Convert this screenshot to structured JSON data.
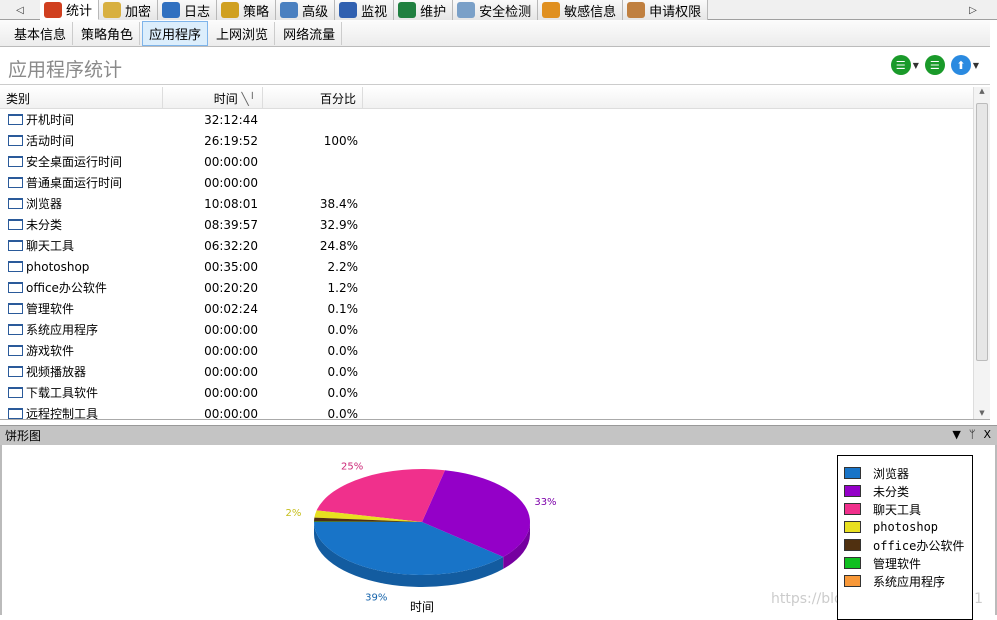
{
  "tabs": [
    {
      "label": "统计",
      "icon": "bar-chart-icon",
      "color": "#d04020",
      "active": true
    },
    {
      "label": "加密",
      "icon": "lock-icon",
      "color": "#d8b040"
    },
    {
      "label": "日志",
      "icon": "log-stack-icon",
      "color": "#3070c0"
    },
    {
      "label": "策略",
      "icon": "policy-gear-icon",
      "color": "#d0a020"
    },
    {
      "label": "高级",
      "icon": "advanced-user-icon",
      "color": "#4a80c0"
    },
    {
      "label": "监视",
      "icon": "camera-icon",
      "color": "#3060b0"
    },
    {
      "label": "维护",
      "icon": "monitor-icon",
      "color": "#208040"
    },
    {
      "label": "安全检测",
      "icon": "security-scan-icon",
      "color": "#7aa0c8"
    },
    {
      "label": "敏感信息",
      "icon": "warning-icon",
      "color": "#e09020"
    },
    {
      "label": "申请权限",
      "icon": "pencil-icon",
      "color": "#c08040"
    }
  ],
  "subtabs": [
    {
      "label": "基本信息"
    },
    {
      "label": "策略角色"
    },
    {
      "label": "应用程序",
      "selected": true
    },
    {
      "label": "上网浏览"
    },
    {
      "label": "网络流量"
    }
  ],
  "page_title": "应用程序统计",
  "table": {
    "headers": [
      "类别",
      "时间",
      "百分比"
    ],
    "sort_indicator": "╲╵",
    "rows": [
      [
        "开机时间",
        "32:12:44",
        ""
      ],
      [
        "活动时间",
        "26:19:52",
        "100%"
      ],
      [
        "安全桌面运行时间",
        "00:00:00",
        ""
      ],
      [
        "普通桌面运行时间",
        "00:00:00",
        ""
      ],
      [
        "浏览器",
        "10:08:01",
        "38.4%"
      ],
      [
        "未分类",
        "08:39:57",
        "32.9%"
      ],
      [
        "聊天工具",
        "06:32:20",
        "24.8%"
      ],
      [
        "photoshop",
        "00:35:00",
        "2.2%"
      ],
      [
        "office办公软件",
        "00:20:20",
        "1.2%"
      ],
      [
        "管理软件",
        "00:02:24",
        "0.1%"
      ],
      [
        "系统应用程序",
        "00:00:00",
        "0.0%"
      ],
      [
        "游戏软件",
        "00:00:00",
        "0.0%"
      ],
      [
        "视频播放器",
        "00:00:00",
        "0.0%"
      ],
      [
        "下载工具软件",
        "00:00:00",
        "0.0%"
      ],
      [
        "远程控制工具",
        "00:00:00",
        "0.0%"
      ]
    ]
  },
  "panel": {
    "title": "饼形图",
    "buttons": [
      "▼",
      "ᛘ",
      "X"
    ]
  },
  "chart_data": {
    "type": "pie",
    "style": "3d",
    "xlabel": "时间",
    "slices": [
      {
        "name": "浏览器",
        "value": 38.4,
        "label": "39%",
        "color": "#1874c8"
      },
      {
        "name": "未分类",
        "value": 32.9,
        "label": "33%",
        "color": "#9400c8"
      },
      {
        "name": "聊天工具",
        "value": 24.8,
        "label": "25%",
        "color": "#f0308c"
      },
      {
        "name": "photoshop",
        "value": 2.2,
        "label": "2%",
        "color": "#e8e020"
      },
      {
        "name": "office办公软件",
        "value": 1.2,
        "label": "",
        "color": "#503010"
      },
      {
        "name": "管理软件",
        "value": 0.1,
        "label": "",
        "color": "#10c020"
      },
      {
        "name": "系统应用程序",
        "value": 0.0,
        "label": "",
        "color": "#f89838"
      }
    ],
    "legend_position": "right"
  },
  "watermark": "https://blog.csdn.net/hupu521"
}
